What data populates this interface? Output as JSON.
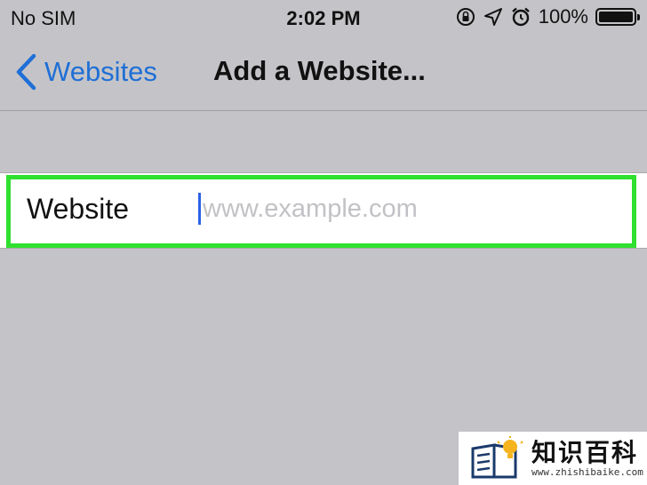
{
  "status_bar": {
    "carrier": "No SIM",
    "time": "2:02 PM",
    "battery_percent": "100%",
    "icons": [
      "orientation-lock-icon",
      "location-arrow-icon",
      "alarm-icon",
      "battery-icon"
    ]
  },
  "nav": {
    "back_label": "Websites",
    "title": "Add a Website..."
  },
  "form": {
    "label": "Website",
    "input_value": "",
    "input_placeholder": "www.example.com"
  },
  "watermark": {
    "title": "知识百科",
    "url": "www.zhishibaike.com"
  },
  "colors": {
    "background": "#c4c4c8",
    "accent": "#1f6fd6",
    "highlight": "#2fe02f",
    "caret": "#2a62e6"
  }
}
